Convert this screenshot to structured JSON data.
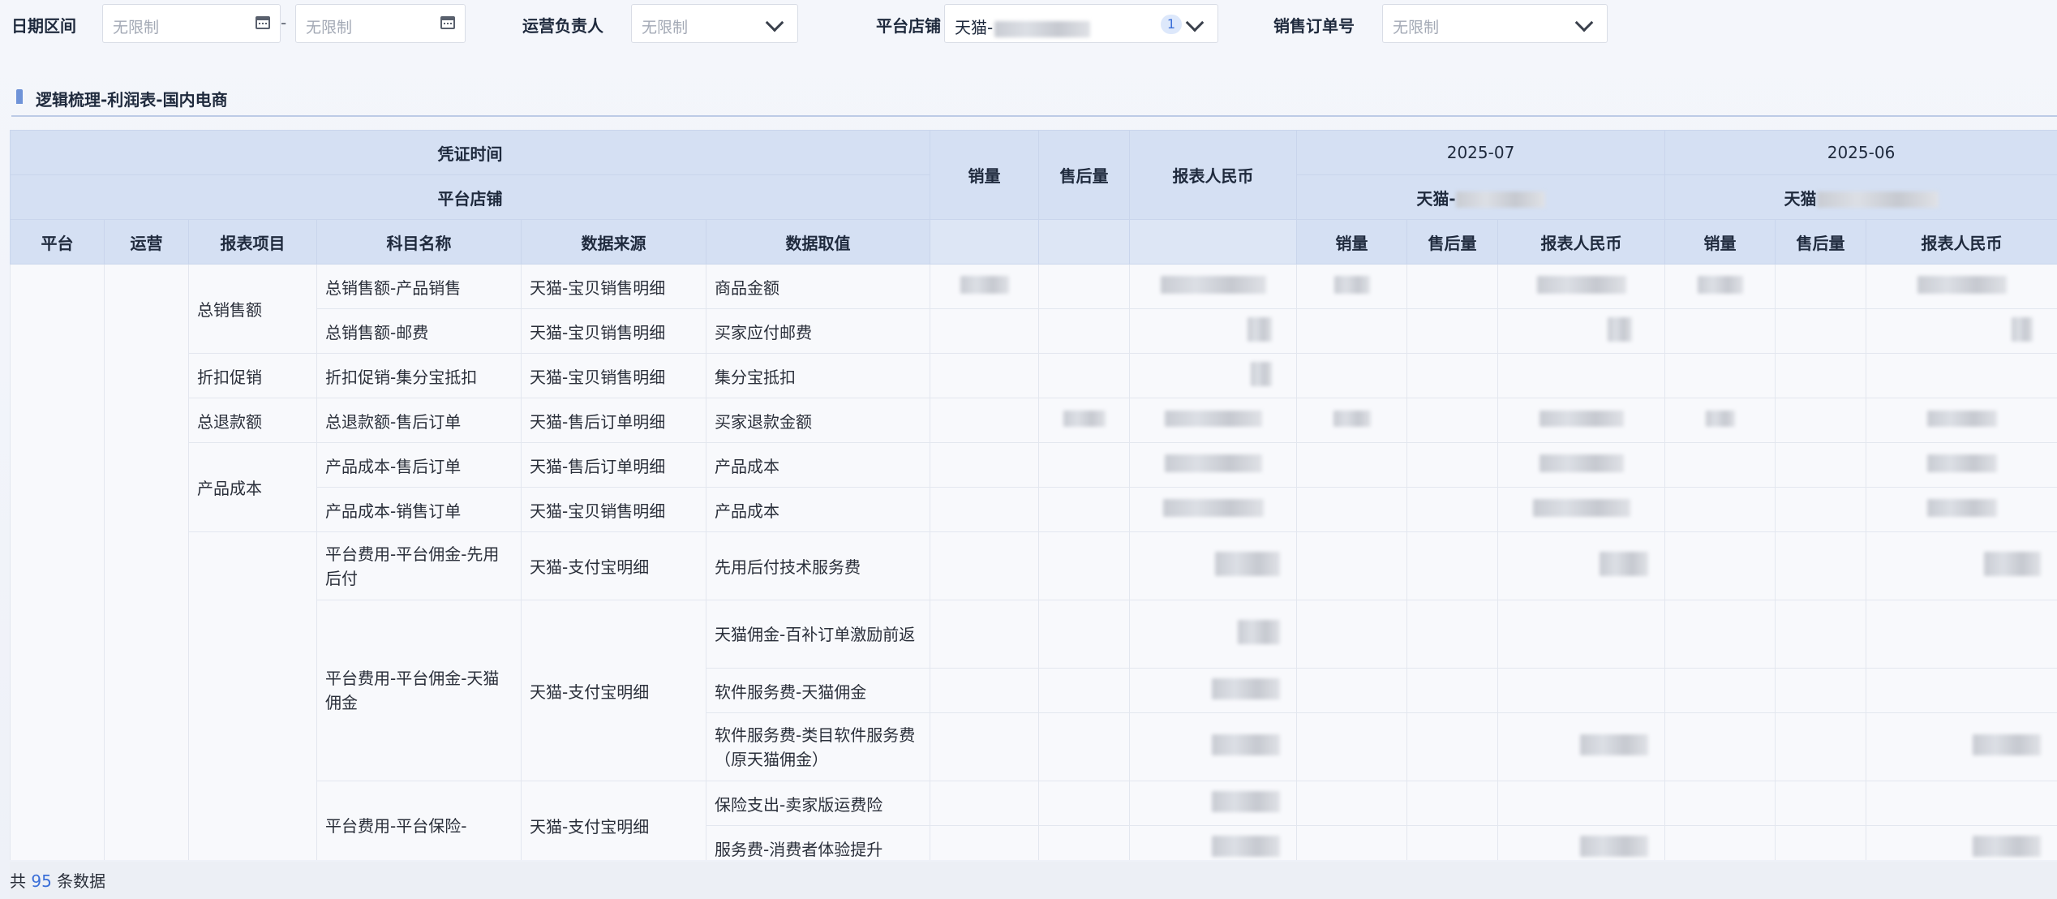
{
  "filters": {
    "date_range": {
      "label": "日期区间",
      "start_placeholder": "无限制",
      "end_placeholder": "无限制",
      "separator": "-"
    },
    "operator": {
      "label": "运营负责人",
      "placeholder": "无限制"
    },
    "store": {
      "label": "平台店铺",
      "value": "天猫-",
      "count": "1"
    },
    "order_no": {
      "label": "销售订单号",
      "placeholder": "无限制"
    }
  },
  "section": {
    "title": "逻辑梳理-利润表-国内电商"
  },
  "table": {
    "header": {
      "voucher_time": "凭证时间",
      "platform_store": "平台店铺",
      "sales_qty": "销量",
      "after_sales_qty": "售后量",
      "report_rmb": "报表人民币",
      "period_1": "2025-07",
      "period_2": "2025-06",
      "store_1": "天猫-",
      "store_2": "天猫",
      "col_platform": "平台",
      "col_operation": "运营",
      "col_report_item": "报表项目",
      "col_subject": "科目名称",
      "col_source": "数据来源",
      "col_value": "数据取值"
    },
    "groups": [
      "总销售额",
      "折扣促销",
      "总退款额",
      "产品成本"
    ],
    "rows": [
      {
        "subject": "总销售额-产品销售",
        "source": "天猫-宝贝销售明细",
        "value": "商品金额"
      },
      {
        "subject": "总销售额-邮费",
        "source": "天猫-宝贝销售明细",
        "value": "买家应付邮费"
      },
      {
        "subject": "折扣促销-集分宝抵扣",
        "source": "天猫-宝贝销售明细",
        "value": "集分宝抵扣"
      },
      {
        "subject": "总退款额-售后订单",
        "source": "天猫-售后订单明细",
        "value": "买家退款金额"
      },
      {
        "subject": "产品成本-售后订单",
        "source": "天猫-售后订单明细",
        "value": "产品成本"
      },
      {
        "subject": "产品成本-销售订单",
        "source": "天猫-宝贝销售明细",
        "value": "产品成本"
      },
      {
        "subject": "平台费用-平台佣金-先用后付",
        "source": "天猫-支付宝明细",
        "value": "先用后付技术服务费"
      },
      {
        "subject": "平台费用-平台佣金-天猫佣金",
        "source": "天猫-支付宝明细",
        "value": "天猫佣金-百补订单激励前返"
      },
      {
        "value": "软件服务费-天猫佣金"
      },
      {
        "value": "软件服务费-类目软件服务费（原天猫佣金）"
      },
      {
        "subject": "平台费用-平台保险-",
        "source": "天猫-支付宝明细",
        "value": "保险支出-卖家版运费险"
      },
      {
        "value": "服务费-消费者体验提升"
      }
    ]
  },
  "footer": {
    "prefix": "共",
    "count": "95",
    "suffix": "条数据"
  }
}
